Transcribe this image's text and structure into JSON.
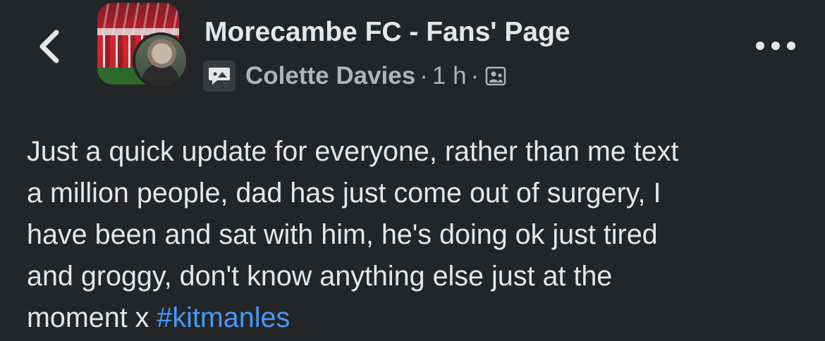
{
  "header": {
    "group_name": "Morecambe FC - Fans' Page",
    "author": "Colette Davies",
    "separator": "·",
    "time": "1 h",
    "icons": {
      "back": "chevron-left-icon",
      "post_type": "chat-bubble-icon",
      "audience": "group-members-icon",
      "more": "more-options-icon"
    }
  },
  "post": {
    "lines": [
      "Just a quick update for everyone, rather than me text",
      "a million people, dad has just come out of surgery, I",
      "have been and sat with him, he's doing ok just tired",
      "and groggy, don't know anything else just at the",
      "moment x "
    ],
    "hashtag": "#kitmanles"
  },
  "colors": {
    "background": "#242526",
    "text": "#e4e6eb",
    "secondary_text": "#b0b3b8",
    "link": "#4599ff"
  }
}
